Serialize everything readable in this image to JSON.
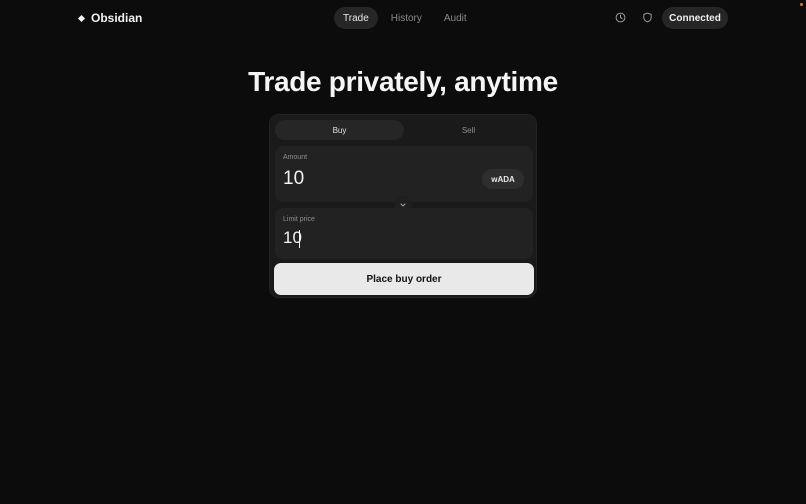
{
  "brand": {
    "name": "Obsidian"
  },
  "nav": {
    "tabs": [
      "Trade",
      "History",
      "Audit"
    ],
    "active": "Trade"
  },
  "header": {
    "icons": [
      "clock-icon",
      "shield-icon"
    ],
    "connected_label": "Connected"
  },
  "hero": {
    "title": "Trade privately, anytime"
  },
  "order": {
    "sides": [
      "Buy",
      "Sell"
    ],
    "active_side": "Buy",
    "amount": {
      "label": "Amount",
      "value": "10",
      "token": "wADA"
    },
    "limit_price": {
      "label": "Limit price",
      "value": "10"
    },
    "submit_label": "Place buy order"
  },
  "colors": {
    "background": "#0c0c0c",
    "card": "#1a1a1a",
    "field": "#222222",
    "button": "#e9e9e9"
  }
}
